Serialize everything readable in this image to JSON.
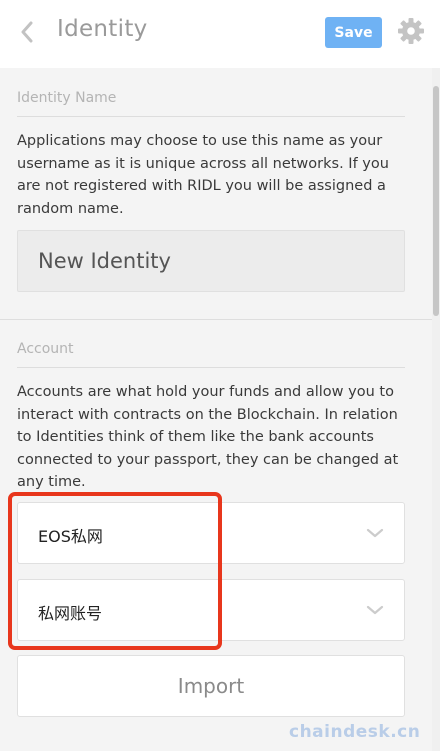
{
  "header": {
    "title": "Identity",
    "save_label": "Save"
  },
  "identity_section": {
    "title": "Identity Name",
    "description": "Applications may choose to use this name as your username as it is unique across all networks. If you are not registered with RIDL you will be assigned a random name.",
    "name_value": "New Identity"
  },
  "account_section": {
    "title": "Account",
    "description": "Accounts are what hold your funds and allow you to interact with contracts on the Blockchain. In relation to Identities think of them like the bank accounts connected to your passport, they can be changed at any time.",
    "network_select": "EOS私网",
    "account_select": "私网账号",
    "import_label": "Import"
  },
  "watermark": "chaindesk.cn",
  "colors": {
    "accent": "#6fb2f4",
    "highlight": "#e8361c"
  },
  "icons": {
    "back": "chevron-left-icon",
    "settings": "gear-icon",
    "select": "chevron-down-icon"
  }
}
